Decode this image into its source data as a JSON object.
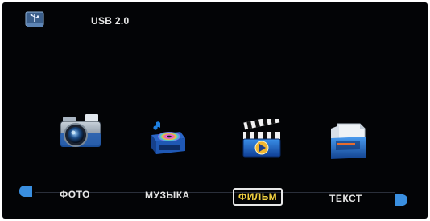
{
  "header": {
    "device_label": "USB 2.0",
    "device_icon": "usb-icon"
  },
  "menu": {
    "items": [
      {
        "label": "ФОТО",
        "icon": "camera-icon"
      },
      {
        "label": "МУЗЫКА",
        "icon": "music-icon"
      },
      {
        "label": "ФИЛЬМ",
        "icon": "clapperboard-icon",
        "selected": true
      },
      {
        "label": "ТЕКСТ",
        "icon": "document-folder-icon"
      }
    ]
  },
  "colors": {
    "background": "#030406",
    "selected_text": "#f0d040",
    "arrow": "#3a8fe0"
  }
}
